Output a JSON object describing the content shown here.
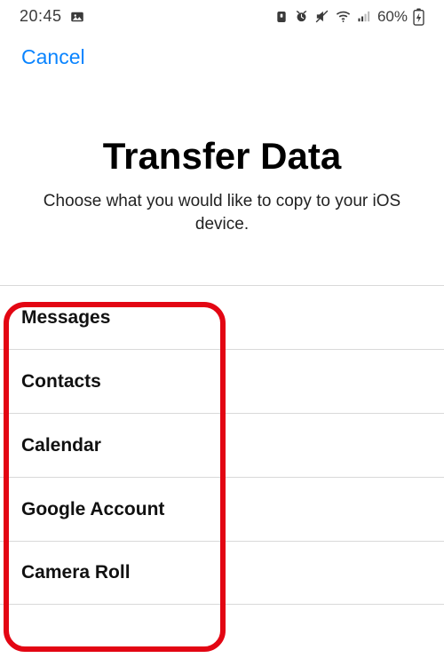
{
  "status": {
    "time": "20:45",
    "battery_text": "60%"
  },
  "nav": {
    "cancel": "Cancel"
  },
  "hero": {
    "title": "Transfer Data",
    "subtitle": "Choose what you would like to copy to your iOS device."
  },
  "list": {
    "items": [
      {
        "label": "Messages"
      },
      {
        "label": "Contacts"
      },
      {
        "label": "Calendar"
      },
      {
        "label": "Google Account"
      },
      {
        "label": "Camera Roll"
      }
    ]
  }
}
